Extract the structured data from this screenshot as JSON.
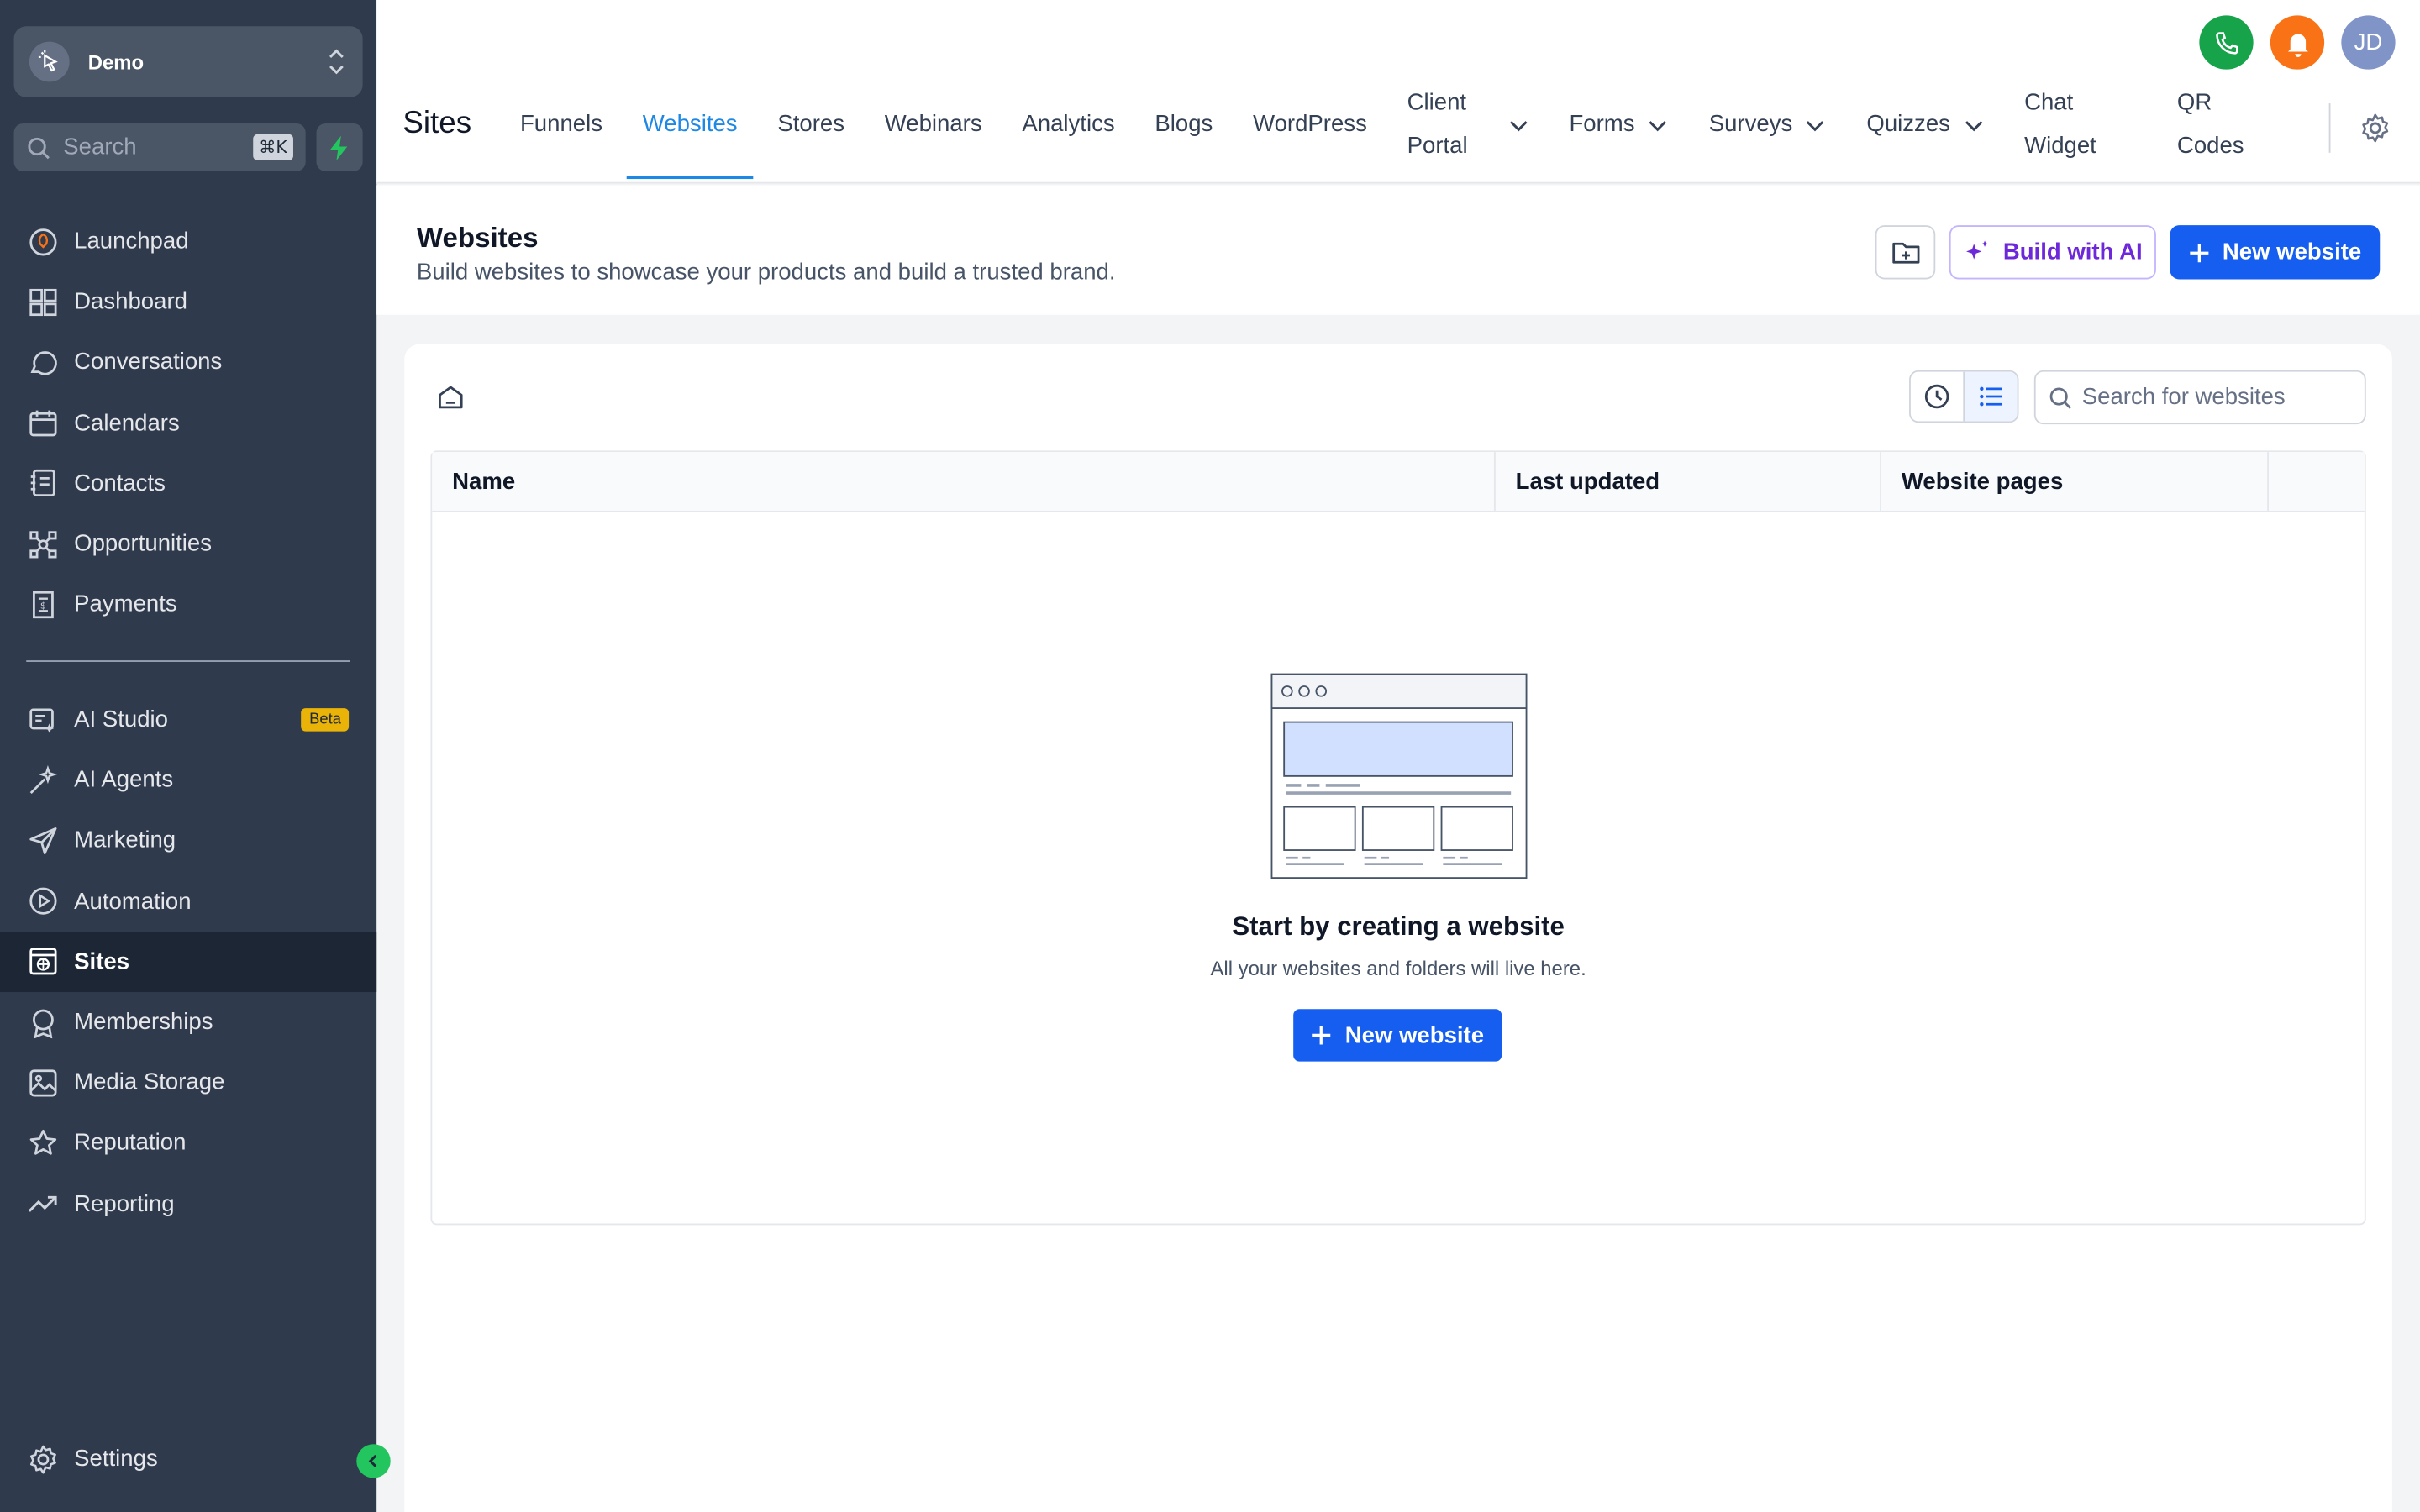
{
  "account": {
    "name": "Demo"
  },
  "search": {
    "placeholder": "Search",
    "shortcut": "⌘K"
  },
  "sidebar": {
    "items": [
      {
        "label": "Launchpad"
      },
      {
        "label": "Dashboard"
      },
      {
        "label": "Conversations"
      },
      {
        "label": "Calendars"
      },
      {
        "label": "Contacts"
      },
      {
        "label": "Opportunities"
      },
      {
        "label": "Payments"
      }
    ],
    "items2": [
      {
        "label": "AI Studio",
        "badge": "Beta"
      },
      {
        "label": "AI Agents"
      },
      {
        "label": "Marketing"
      },
      {
        "label": "Automation"
      },
      {
        "label": "Sites",
        "active": true
      },
      {
        "label": "Memberships"
      },
      {
        "label": "Media Storage"
      },
      {
        "label": "Reputation"
      },
      {
        "label": "Reporting"
      }
    ],
    "settings": "Settings"
  },
  "topbar": {
    "avatar": "JD",
    "title": "Sites",
    "tabs": {
      "funnels": "Funnels",
      "websites": "Websites",
      "stores": "Stores",
      "webinars": "Webinars",
      "analytics": "Analytics",
      "blogs": "Blogs",
      "wordpress": "WordPress",
      "client_portal_1": "Client",
      "client_portal_2": "Portal",
      "forms": "Forms",
      "surveys": "Surveys",
      "quizzes": "Quizzes",
      "chat_widget_1": "Chat",
      "chat_widget_2": "Widget",
      "qr_codes_1": "QR",
      "qr_codes_2": "Codes"
    }
  },
  "header": {
    "title": "Websites",
    "subtitle": "Build websites to showcase your products and build a trusted brand.",
    "build_ai": "Build with AI",
    "new_website": "New website"
  },
  "card": {
    "search_placeholder": "Search for websites",
    "columns": [
      "Name",
      "Last updated",
      "Website pages"
    ],
    "empty_title": "Start by creating a website",
    "empty_subtitle": "All your websites and folders will live here.",
    "empty_button": "New website"
  },
  "colors": {
    "sidebar_bg": "#2f3a4c",
    "primary": "#155eef",
    "active_tab": "#1e88e5",
    "ai_purple": "#6d28d9"
  }
}
